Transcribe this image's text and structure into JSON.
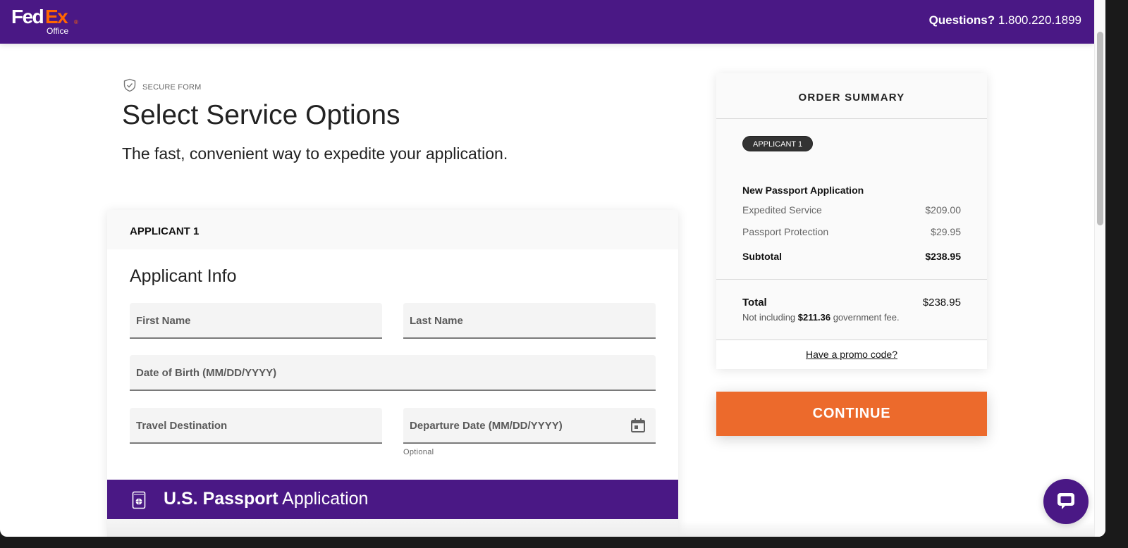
{
  "header": {
    "logo": {
      "fed": "Fed",
      "ex": "Ex",
      "reg": "®",
      "office": "Office"
    },
    "questions_label": "Questions?",
    "phone": "1.800.220.1899",
    "colors": {
      "brand_purple": "#4a1885",
      "brand_orange": "#ff6600"
    }
  },
  "page": {
    "secure_label": "SECURE FORM",
    "title": "Select Service Options",
    "subtitle": "The fast, convenient way to expedite your application."
  },
  "applicant_card": {
    "header": "APPLICANT 1",
    "section_title": "Applicant Info",
    "fields": {
      "first_name": {
        "placeholder": "First Name",
        "value": ""
      },
      "last_name": {
        "placeholder": "Last Name",
        "value": ""
      },
      "dob": {
        "placeholder": "Date of Birth (MM/DD/YYYY)",
        "value": ""
      },
      "destination": {
        "placeholder": "Travel Destination",
        "value": ""
      },
      "departure": {
        "placeholder": "Departure Date (MM/DD/YYYY)",
        "value": "",
        "hint": "Optional"
      }
    },
    "passport_section": {
      "bold": "U.S. Passport",
      "light": "Application"
    }
  },
  "order_summary": {
    "title": "ORDER SUMMARY",
    "badge": "APPLICANT 1",
    "item_title": "New Passport Application",
    "lines": [
      {
        "label": "Expedited Service",
        "amount": "$209.00"
      },
      {
        "label": "Passport Protection",
        "amount": "$29.95"
      }
    ],
    "subtotal": {
      "label": "Subtotal",
      "amount": "$238.95"
    },
    "total": {
      "label": "Total",
      "amount": "$238.95",
      "note_prefix": "Not including",
      "note_amount": "$211.36",
      "note_suffix": "government fee."
    },
    "promo_link": "Have a promo code?"
  },
  "actions": {
    "continue_label": "CONTINUE",
    "continue_color": "#ec6a2c"
  },
  "icons": {
    "secure": "shield-check-icon",
    "calendar": "calendar-icon",
    "passport": "passport-icon",
    "chat": "chat-bubble-icon"
  }
}
